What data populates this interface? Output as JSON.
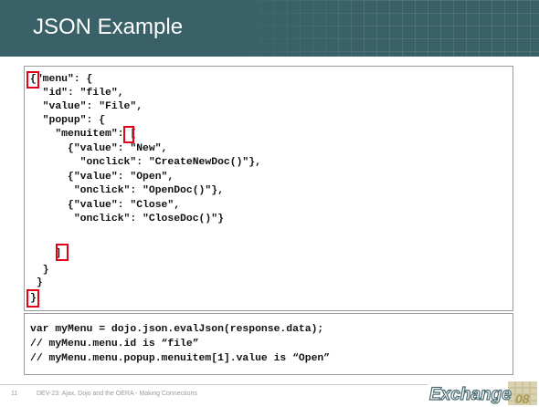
{
  "slide": {
    "title": "JSON Example",
    "number": "11",
    "footer": "DEV-23: Ajax, Dojo and the OERA - Making Connections"
  },
  "code": {
    "lines": [
      "{\"menu\": {",
      "  \"id\": \"file\",",
      "  \"value\": \"File\",",
      "  \"popup\": {",
      "    \"menuitem\": [",
      "      {\"value\": \"New\",",
      "        \"onclick\": \"CreateNewDoc()\"},",
      "      {\"value\": \"Open\",",
      "       \"onclick\": \"OpenDoc()\"},",
      "      {\"value\": \"Close\",",
      "       \"onclick\": \"CloseDoc()\"}",
      "    ]",
      "  }",
      " }",
      "}"
    ],
    "usage_lines": [
      "var myMenu = dojo.json.evalJson(response.data);",
      "// myMenu.menu.id is “file”",
      "// myMenu.menu.popup.menuitem[1].value is “Open”"
    ]
  },
  "logo": {
    "text": "Exchange",
    "suffix": "08"
  },
  "colors": {
    "title_bg": "#3a6168",
    "highlight": "#e3001b"
  }
}
